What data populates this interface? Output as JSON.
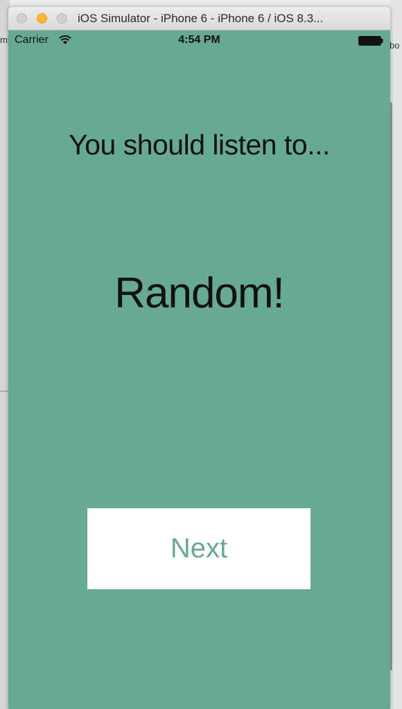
{
  "window": {
    "title": "iOS Simulator - iPhone 6 - iPhone 6 / iOS 8.3..."
  },
  "background": {
    "left_text": "mb",
    "right_text": "bo"
  },
  "status_bar": {
    "carrier": "Carrier",
    "time": "4:54 PM",
    "icons": [
      "wifi-icon",
      "battery-icon"
    ]
  },
  "app": {
    "headline": "You should listen to...",
    "result": "Random!",
    "next_label": "Next"
  },
  "colors": {
    "app_background": "#66aa96",
    "button_background": "#ffffff",
    "button_text": "#66aa96",
    "minimize_traffic_light": "#fbb832"
  }
}
